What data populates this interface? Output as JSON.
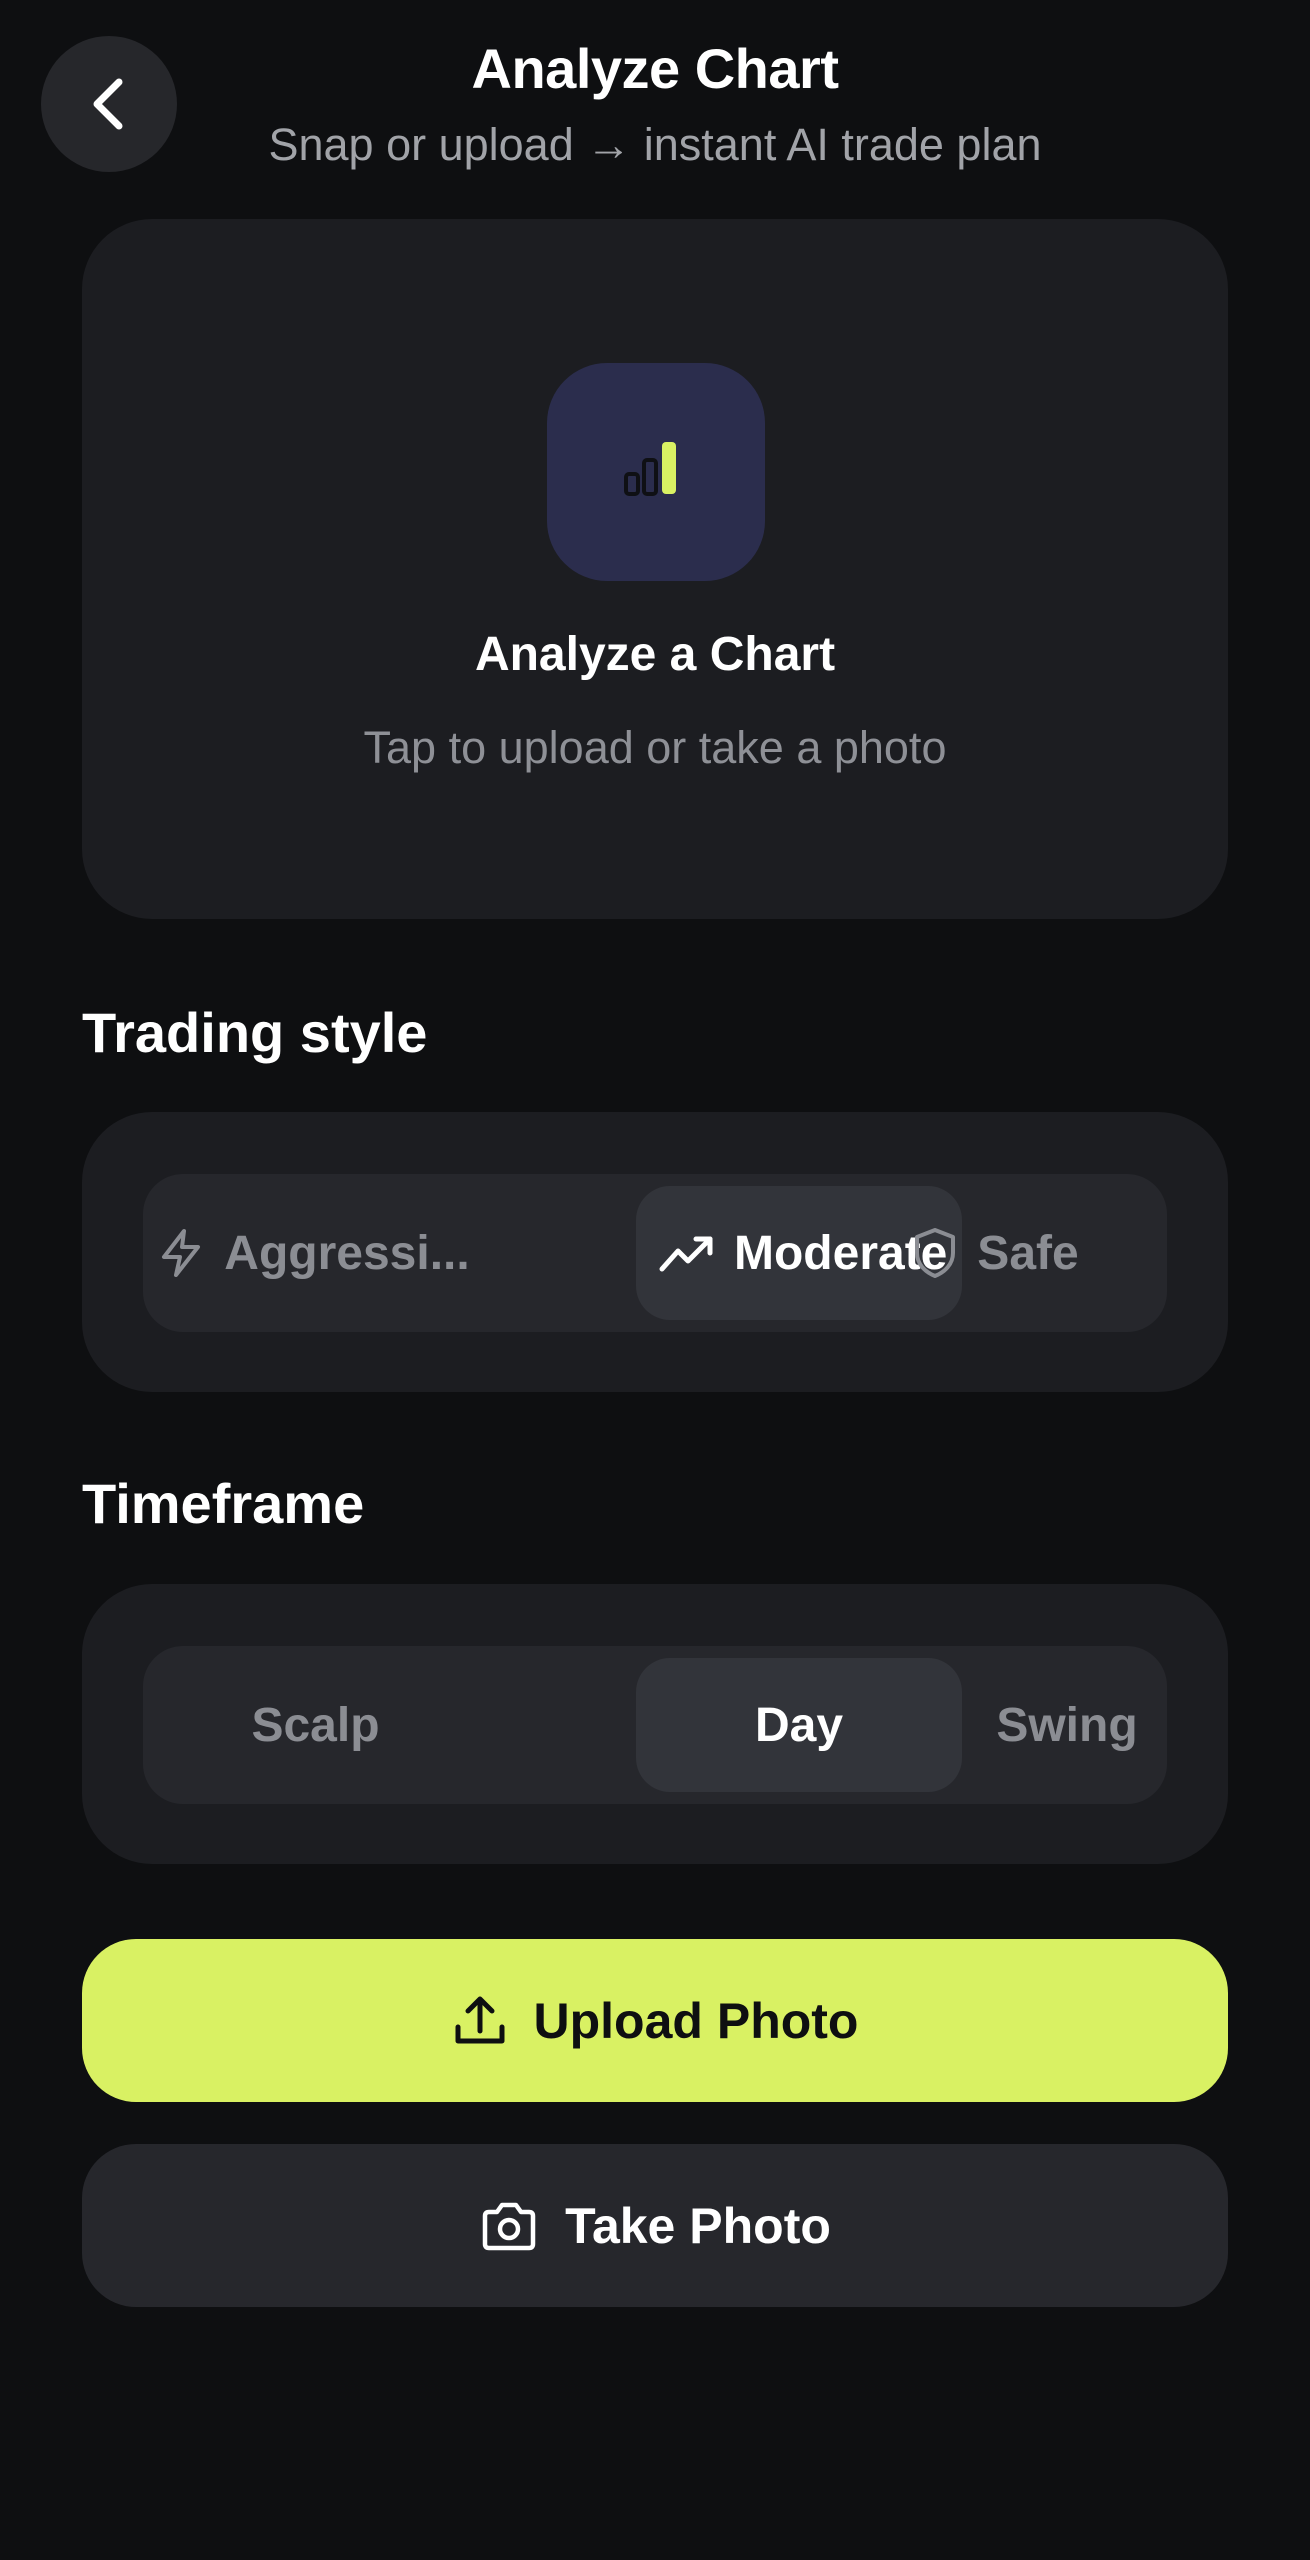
{
  "header": {
    "back_icon": "chevron-left-icon",
    "title": "Analyze Chart",
    "subtitle": "Snap or upload → instant AI trade plan"
  },
  "upload_card": {
    "icon": "bar-chart-icon",
    "title": "Analyze a Chart",
    "subtitle": "Tap to upload or take a photo"
  },
  "trading_style": {
    "label": "Trading style",
    "options": [
      {
        "label": "Aggressi...",
        "icon": "lightning-icon",
        "selected": false
      },
      {
        "label": "Moderate",
        "icon": "trending-up-icon",
        "selected": true
      },
      {
        "label": "Safe",
        "icon": "shield-icon",
        "selected": false
      }
    ]
  },
  "timeframe": {
    "label": "Timeframe",
    "options": [
      {
        "label": "Scalp",
        "selected": false
      },
      {
        "label": "Day",
        "selected": true
      },
      {
        "label": "Swing",
        "selected": false
      }
    ]
  },
  "actions": {
    "upload_label": "Upload Photo",
    "upload_icon": "upload-icon",
    "take_label": "Take Photo",
    "take_icon": "camera-icon"
  },
  "colors": {
    "background": "#0e0f11",
    "card": "#1c1d21",
    "accent": "#d9f163",
    "tile": "#2b2d4d",
    "muted_text": "#8b8d93"
  }
}
